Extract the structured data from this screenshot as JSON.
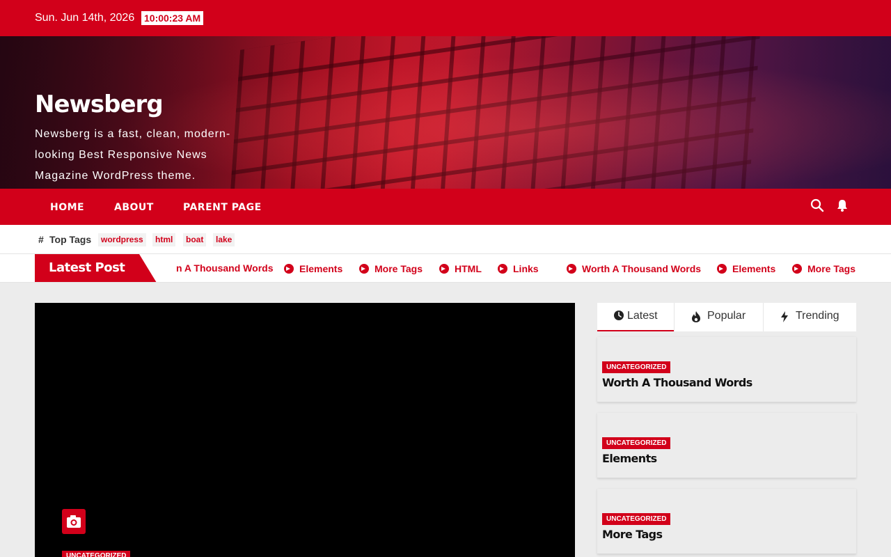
{
  "topbar": {
    "date": "Sun. Jun 14th, 2026",
    "time": "10:00:23 AM"
  },
  "site": {
    "name": "Newsberg",
    "tagline": "Newsberg is a fast, clean, modern-looking Best Responsive News Magazine WordPress theme."
  },
  "nav": {
    "items": [
      {
        "label": "HOME"
      },
      {
        "label": "ABOUT"
      },
      {
        "label": "PARENT PAGE"
      }
    ],
    "icons": [
      "search-icon",
      "bell-icon"
    ]
  },
  "tags": {
    "hash": "#",
    "label": "Top Tags",
    "items": [
      "wordpress",
      "html",
      "boat",
      "lake"
    ]
  },
  "ticker": {
    "label": "Latest Post",
    "items": [
      {
        "label": "n A Thousand Words"
      },
      {
        "label": "Elements"
      },
      {
        "label": "More Tags"
      },
      {
        "label": "HTML"
      },
      {
        "label": "Links"
      },
      {
        "label": "Worth A Thousand Words"
      },
      {
        "label": "Elements"
      },
      {
        "label": "More Tags"
      }
    ]
  },
  "featured": {
    "category": "UNCATEGORIZED",
    "icon": "camera-icon"
  },
  "sidebar": {
    "tabs": [
      {
        "label": "Latest",
        "icon": "clock-icon"
      },
      {
        "label": "Popular",
        "icon": "fire-icon"
      },
      {
        "label": "Trending",
        "icon": "bolt-icon"
      }
    ],
    "posts": [
      {
        "category": "UNCATEGORIZED",
        "title": "Worth A Thousand Words"
      },
      {
        "category": "UNCATEGORIZED",
        "title": "Elements"
      },
      {
        "category": "UNCATEGORIZED",
        "title": "More Tags"
      }
    ]
  },
  "colors": {
    "accent": "#d2001a",
    "background": "#ececec"
  }
}
